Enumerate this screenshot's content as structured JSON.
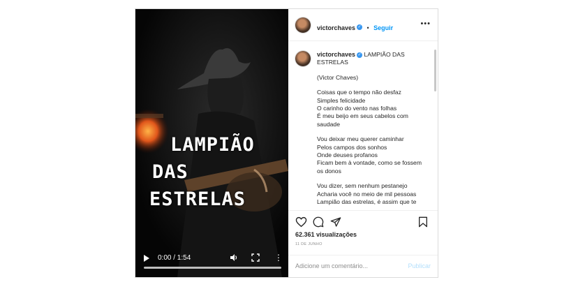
{
  "video": {
    "title_lines": [
      "LAMPIÃO",
      "DAS",
      "ESTRELAS"
    ],
    "time": "0:00 / 1:54",
    "progress": 0
  },
  "header": {
    "username": "victorchaves",
    "separator": "•",
    "follow_label": "Seguir",
    "more_label": "•••"
  },
  "caption": {
    "username": "victorchaves",
    "title": "LAMPIÃO DAS ESTRELAS",
    "author": "(Victor Chaves)",
    "stanzas": [
      [
        "Coisas que o tempo não desfaz",
        "Simples felicidade",
        "O carinho do vento nas folhas",
        "É meu beijo em seus cabelos com saudade"
      ],
      [
        "Vou deixar meu querer caminhar",
        "Pelos campos dos sonhos",
        "Onde deuses profanos",
        "Ficam bem à vontade, como se fossem os donos"
      ],
      [
        "Vou dizer, sem nenhum pestanejo",
        "Acharia você no meio de mil pessoas",
        "Lampião das estrelas, é assim que te"
      ]
    ]
  },
  "stats": {
    "views": "62.361 visualizações",
    "date": "11 DE JUNHO"
  },
  "comment": {
    "placeholder": "Adicione um comentário...",
    "publish_label": "Publicar"
  },
  "icons": {
    "verified": "verified-badge-icon",
    "like": "heart-icon",
    "comment": "comment-icon",
    "share": "share-icon",
    "save": "bookmark-icon"
  },
  "colors": {
    "follow": "#0095f6",
    "verified": "#3897f0",
    "publish_disabled": "#b2dffc"
  }
}
